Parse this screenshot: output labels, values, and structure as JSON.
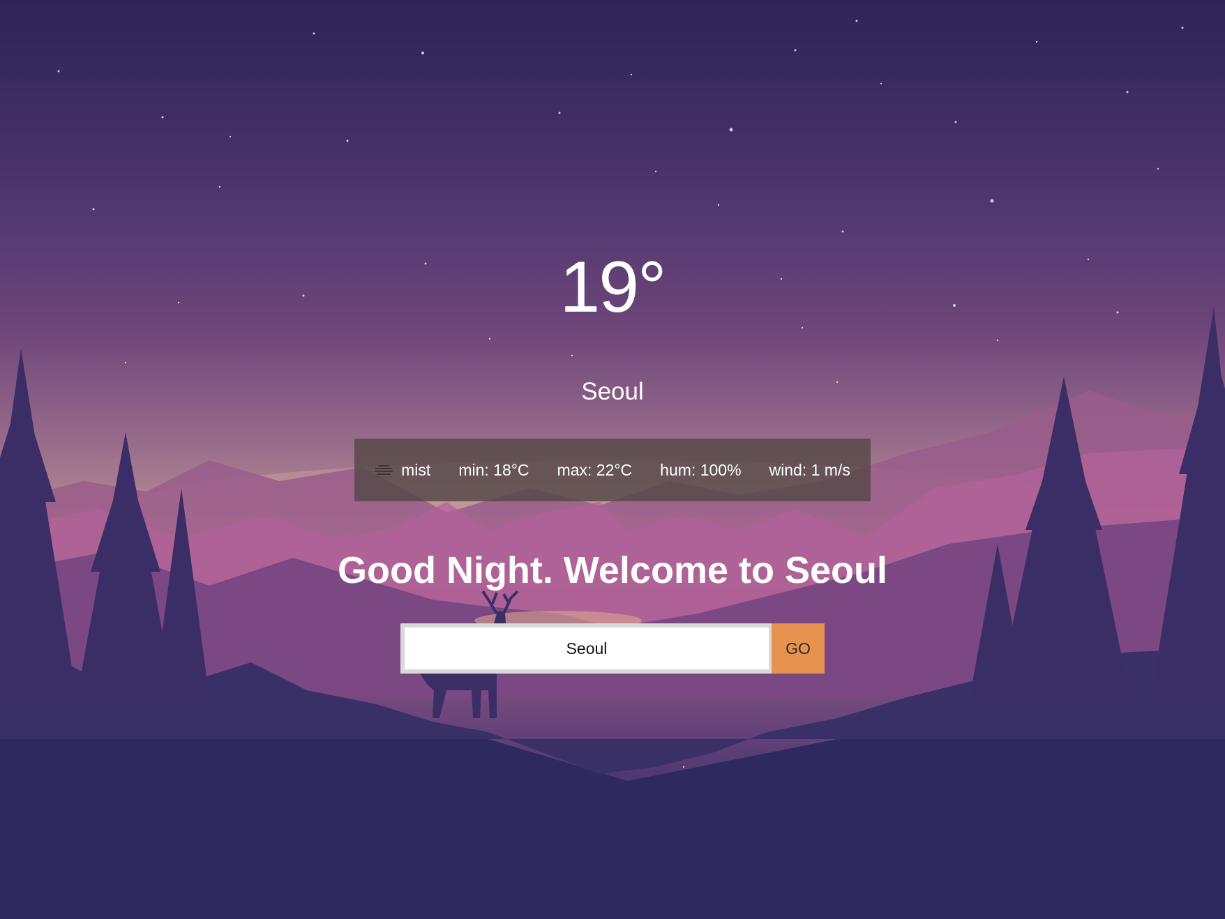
{
  "weather": {
    "temperature": "19°",
    "city": "Seoul",
    "condition_icon": "mist-icon",
    "condition": "mist",
    "min": "min: 18°C",
    "max": "max: 22°C",
    "humidity": "hum: 100%",
    "wind": "wind: 1 m/s"
  },
  "greeting": "Good Night. Welcome to Seoul",
  "search": {
    "value": "Seoul",
    "button_label": "GO"
  },
  "colors": {
    "accent": "#e8924f",
    "panel": "#554848",
    "sky_top": "#2e2556",
    "horizon": "#c59693",
    "ground": "#2f2a5e"
  }
}
